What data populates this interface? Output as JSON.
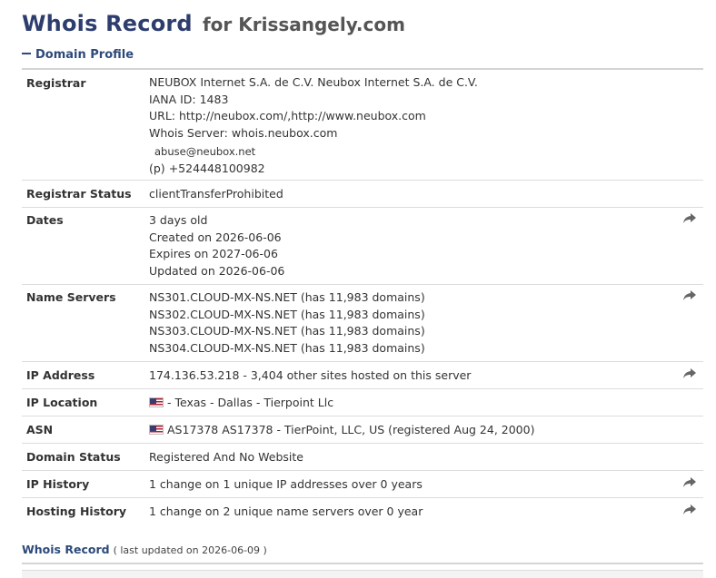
{
  "header": {
    "title": "Whois Record",
    "subtitle": "for Krissangely.com"
  },
  "section": {
    "label": "Domain Profile"
  },
  "profile": {
    "registrar": {
      "label": "Registrar",
      "lines": [
        "NEUBOX Internet S.A. de C.V. Neubox Internet S.A. de C.V.",
        "IANA ID: 1483",
        "URL: http://neubox.com/,http://www.neubox.com",
        "Whois Server: whois.neubox.com"
      ],
      "email": "abuse@neubox.net",
      "phone_label": "(p)",
      "phone": "+524448100982"
    },
    "registrar_status": {
      "label": "Registrar Status",
      "value": "clientTransferProhibited"
    },
    "dates": {
      "label": "Dates",
      "lines": [
        "3 days old",
        "Created on 2026-06-06",
        "Expires on 2027-06-06",
        "Updated on 2026-06-06"
      ]
    },
    "name_servers": {
      "label": "Name Servers",
      "lines": [
        "NS301.CLOUD-MX-NS.NET (has 11,983 domains)",
        "NS302.CLOUD-MX-NS.NET (has 11,983 domains)",
        "NS303.CLOUD-MX-NS.NET (has 11,983 domains)",
        "NS304.CLOUD-MX-NS.NET (has 11,983 domains)"
      ]
    },
    "ip_address": {
      "label": "IP Address",
      "value": "174.136.53.218 - 3,404 other sites hosted on this server"
    },
    "ip_location": {
      "label": "IP Location",
      "value": "- Texas - Dallas - Tierpoint Llc"
    },
    "asn": {
      "label": "ASN",
      "value": "AS17378 AS17378 - TierPoint, LLC, US (registered Aug 24, 2000)"
    },
    "domain_status": {
      "label": "Domain Status",
      "value": "Registered And No Website"
    },
    "ip_history": {
      "label": "IP History",
      "value": "1 change on 1 unique IP addresses over 0 years"
    },
    "hosting_history": {
      "label": "Hosting History",
      "value": "1 change on 2 unique name servers over 0 year"
    }
  },
  "footer": {
    "label": "Whois Record",
    "updated": "( last updated on 2026-06-09 )"
  },
  "icons": {
    "share": "share-arrow-icon",
    "flag": "us-flag-icon",
    "collapse": "minus-icon"
  },
  "colors": {
    "title": "#2d3e6e",
    "link": "#2d4a7a",
    "divider": "#dcdcdc"
  }
}
